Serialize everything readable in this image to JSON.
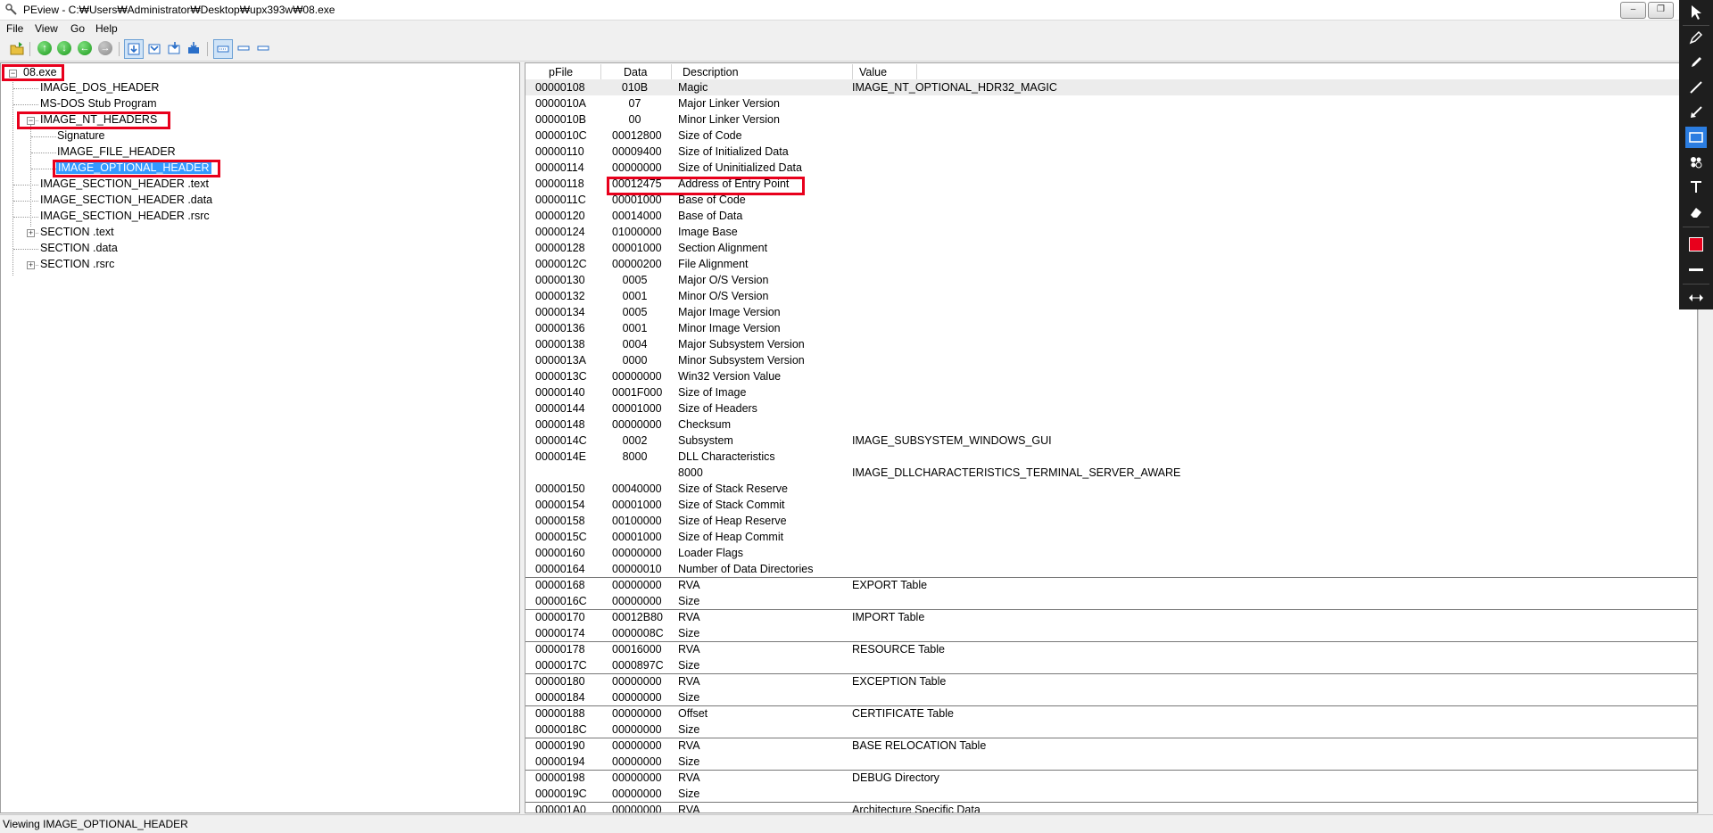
{
  "window": {
    "title": "PEview - C:₩Users₩Administrator₩Desktop₩upx393w₩08.exe",
    "minimize": "–",
    "restore": "❐",
    "close": "✕"
  },
  "menu": [
    "File",
    "View",
    "Go",
    "Help"
  ],
  "toolbar": {
    "icons": [
      "open-icon",
      "back-icon",
      "down-icon",
      "previous-icon",
      "forward-icon",
      "view-hex-icon",
      "view-byte-icon",
      "view-word-icon",
      "view-dword-icon",
      "view-details-icon",
      "view-list-icon",
      "view-small-icon"
    ]
  },
  "tree": {
    "root": "08.exe",
    "items": [
      {
        "label": "IMAGE_DOS_HEADER"
      },
      {
        "label": "MS-DOS Stub Program"
      },
      {
        "label": "IMAGE_NT_HEADERS"
      },
      {
        "label": "Signature"
      },
      {
        "label": "IMAGE_FILE_HEADER"
      },
      {
        "label": "IMAGE_OPTIONAL_HEADER"
      },
      {
        "label": "IMAGE_SECTION_HEADER .text"
      },
      {
        "label": "IMAGE_SECTION_HEADER .data"
      },
      {
        "label": "IMAGE_SECTION_HEADER .rsrc"
      },
      {
        "label": "SECTION .text"
      },
      {
        "label": "SECTION .data"
      },
      {
        "label": "SECTION .rsrc"
      }
    ]
  },
  "grid": {
    "headers": [
      "pFile",
      "Data",
      "Description",
      "Value"
    ],
    "rows": [
      [
        "00000108",
        "010B",
        "Magic",
        "IMAGE_NT_OPTIONAL_HDR32_MAGIC"
      ],
      [
        "0000010A",
        "07",
        "Major Linker Version",
        ""
      ],
      [
        "0000010B",
        "00",
        "Minor Linker Version",
        ""
      ],
      [
        "0000010C",
        "00012800",
        "Size of Code",
        ""
      ],
      [
        "00000110",
        "00009400",
        "Size of Initialized Data",
        ""
      ],
      [
        "00000114",
        "00000000",
        "Size of Uninitialized Data",
        ""
      ],
      [
        "00000118",
        "00012475",
        "Address of Entry Point",
        ""
      ],
      [
        "0000011C",
        "00001000",
        "Base of Code",
        ""
      ],
      [
        "00000120",
        "00014000",
        "Base of Data",
        ""
      ],
      [
        "00000124",
        "01000000",
        "Image Base",
        ""
      ],
      [
        "00000128",
        "00001000",
        "Section Alignment",
        ""
      ],
      [
        "0000012C",
        "00000200",
        "File Alignment",
        ""
      ],
      [
        "00000130",
        "0005",
        "Major O/S Version",
        ""
      ],
      [
        "00000132",
        "0001",
        "Minor O/S Version",
        ""
      ],
      [
        "00000134",
        "0005",
        "Major Image Version",
        ""
      ],
      [
        "00000136",
        "0001",
        "Minor Image Version",
        ""
      ],
      [
        "00000138",
        "0004",
        "Major Subsystem Version",
        ""
      ],
      [
        "0000013A",
        "0000",
        "Minor Subsystem Version",
        ""
      ],
      [
        "0000013C",
        "00000000",
        "Win32 Version Value",
        ""
      ],
      [
        "00000140",
        "0001F000",
        "Size of Image",
        ""
      ],
      [
        "00000144",
        "00001000",
        "Size of Headers",
        ""
      ],
      [
        "00000148",
        "00000000",
        "Checksum",
        ""
      ],
      [
        "0000014C",
        "0002",
        "Subsystem",
        "IMAGE_SUBSYSTEM_WINDOWS_GUI"
      ],
      [
        "0000014E",
        "8000",
        "DLL Characteristics",
        ""
      ],
      [
        "",
        "",
        "8000",
        "IMAGE_DLLCHARACTERISTICS_TERMINAL_SERVER_AWARE"
      ],
      [
        "00000150",
        "00040000",
        "Size of Stack Reserve",
        ""
      ],
      [
        "00000154",
        "00001000",
        "Size of Stack Commit",
        ""
      ],
      [
        "00000158",
        "00100000",
        "Size of Heap Reserve",
        ""
      ],
      [
        "0000015C",
        "00001000",
        "Size of Heap Commit",
        ""
      ],
      [
        "00000160",
        "00000000",
        "Loader Flags",
        ""
      ],
      [
        "00000164",
        "00000010",
        "Number of Data Directories",
        ""
      ],
      [
        "00000168",
        "00000000",
        "RVA",
        "EXPORT Table"
      ],
      [
        "0000016C",
        "00000000",
        "Size",
        ""
      ],
      [
        "00000170",
        "00012B80",
        "RVA",
        "IMPORT Table"
      ],
      [
        "00000174",
        "0000008C",
        "Size",
        ""
      ],
      [
        "00000178",
        "00016000",
        "RVA",
        "RESOURCE Table"
      ],
      [
        "0000017C",
        "0000897C",
        "Size",
        ""
      ],
      [
        "00000180",
        "00000000",
        "RVA",
        "EXCEPTION Table"
      ],
      [
        "00000184",
        "00000000",
        "Size",
        ""
      ],
      [
        "00000188",
        "00000000",
        "Offset",
        "CERTIFICATE Table"
      ],
      [
        "0000018C",
        "00000000",
        "Size",
        ""
      ],
      [
        "00000190",
        "00000000",
        "RVA",
        "BASE RELOCATION Table"
      ],
      [
        "00000194",
        "00000000",
        "Size",
        ""
      ],
      [
        "00000198",
        "00000000",
        "RVA",
        "DEBUG Directory"
      ],
      [
        "0000019C",
        "00000000",
        "Size",
        ""
      ],
      [
        "000001A0",
        "00000000",
        "RVA",
        "Architecture Specific Data"
      ]
    ]
  },
  "status": "Viewing IMAGE_OPTIONAL_HEADER",
  "annotation_toolbar": {
    "tools": [
      "cursor-icon",
      "pen-icon",
      "marker-icon",
      "line-icon",
      "arrow-icon",
      "rectangle-icon",
      "blur-icon",
      "text-icon",
      "eraser-icon",
      "color-swatch-icon",
      "stroke-width-icon",
      "expand-icon"
    ],
    "active_tool": "rectangle-icon",
    "color": "#e8001c"
  },
  "colors": {
    "highlight": "#e8001c",
    "selection": "#3399ff"
  }
}
